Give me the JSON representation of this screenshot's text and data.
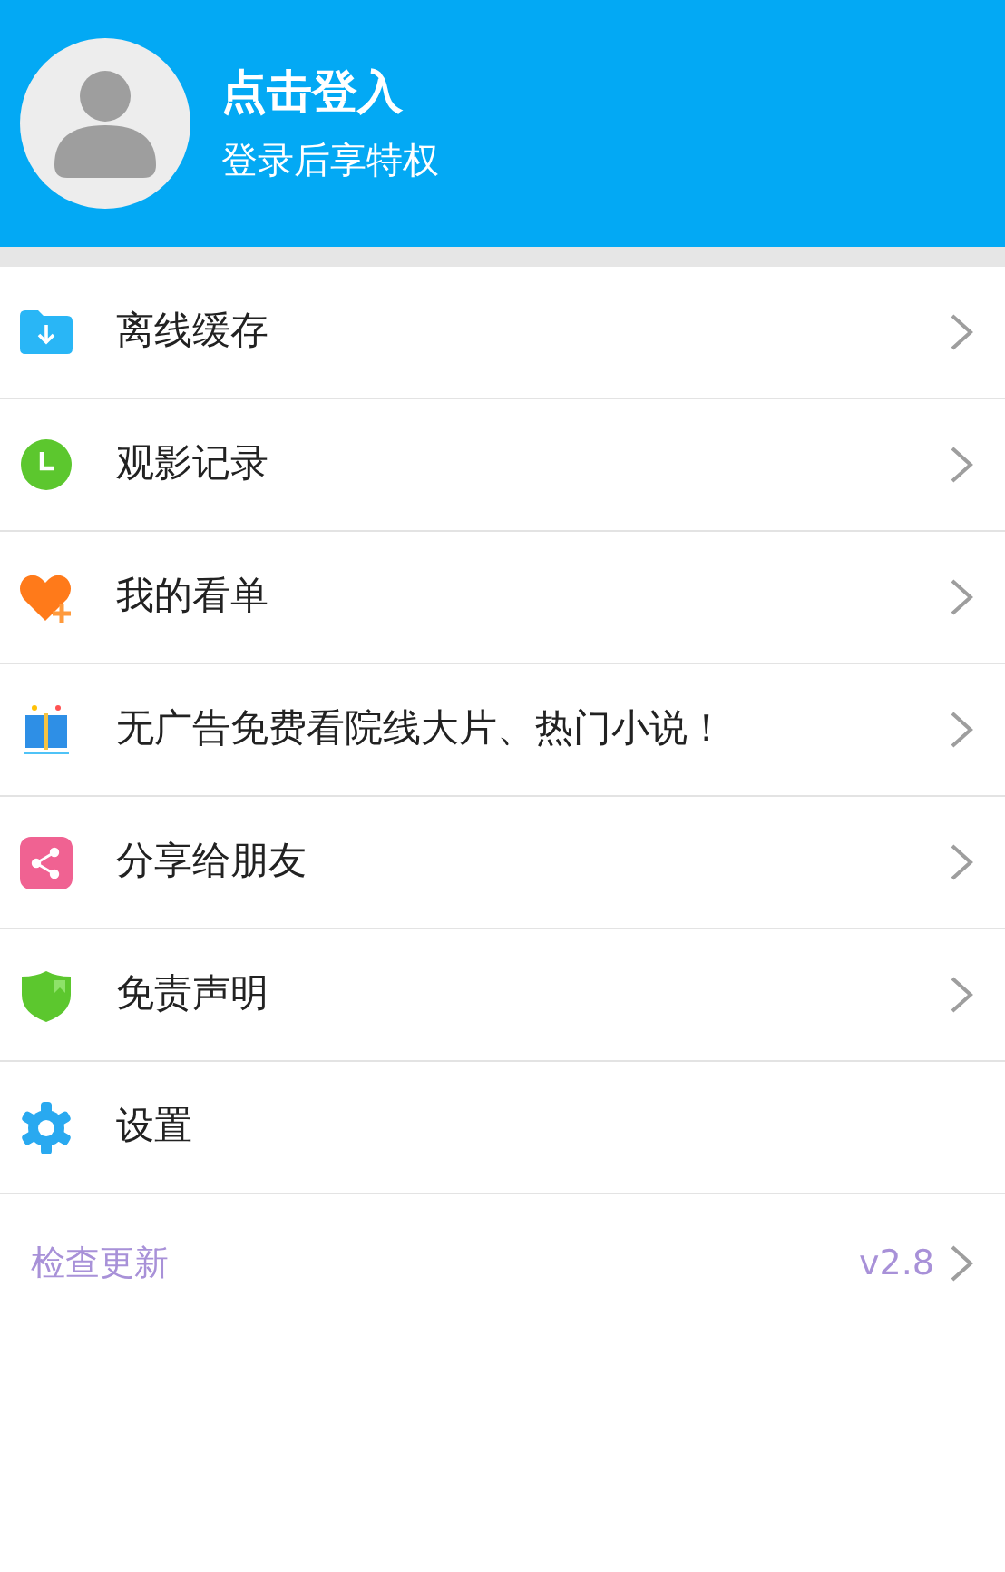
{
  "header": {
    "title": "点击登入",
    "subtitle": "登录后享特权"
  },
  "menu": [
    {
      "kind": "folder",
      "label": "离线缓存",
      "chevron": true
    },
    {
      "kind": "clock",
      "label": "观影记录",
      "chevron": true
    },
    {
      "kind": "heart",
      "label": "我的看单",
      "chevron": true
    },
    {
      "kind": "book",
      "label": "无广告免费看院线大片、热门小说！",
      "chevron": true
    },
    {
      "kind": "share",
      "label": "分享给朋友",
      "chevron": true
    },
    {
      "kind": "shield",
      "label": "免责声明",
      "chevron": true
    },
    {
      "kind": "gear",
      "label": "设置",
      "chevron": false
    }
  ],
  "update": {
    "label": "检查更新",
    "version": "v2.8"
  }
}
